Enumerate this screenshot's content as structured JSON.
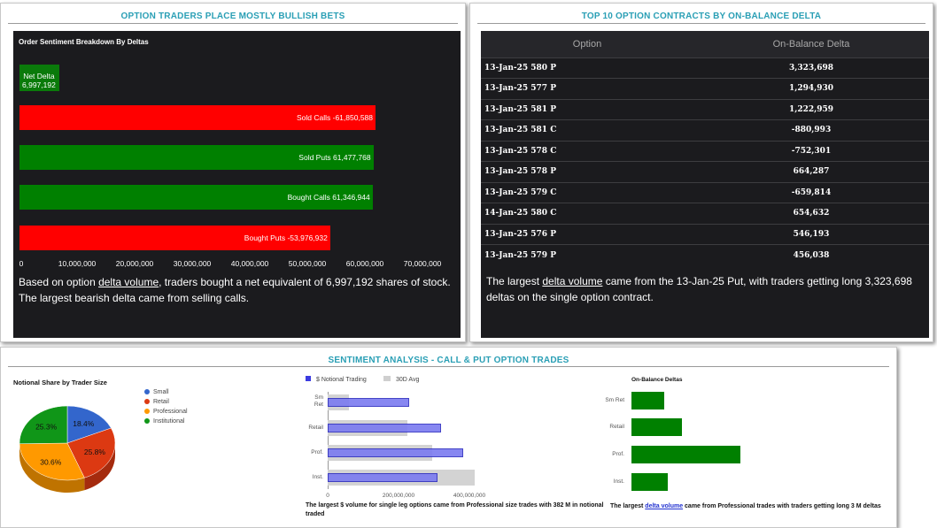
{
  "left_panel": {
    "title": "OPTION TRADERS PLACE MOSTLY BULLISH BETS",
    "chart_data": {
      "type": "bar",
      "orientation": "horizontal",
      "title": "Order Sentiment Breakdown By Deltas",
      "categories": [
        "Net Delta",
        "Sold Calls",
        "Sold Puts",
        "Bought Calls",
        "Bought Puts"
      ],
      "values": [
        6997192,
        -61850588,
        61477768,
        61346944,
        -53976932
      ],
      "labels": [
        "Net Delta\n6,997,192",
        "Sold Calls -61,850,588",
        "Sold Puts 61,477,768",
        "Bought Calls 61,346,944",
        "Bought Puts -53,976,932"
      ],
      "colors": [
        "#0a7a0a",
        "#ff0000",
        "#008000",
        "#008000",
        "#ff0000"
      ],
      "xlim": [
        0,
        70000000
      ],
      "xticks": [
        "0",
        "10,000,000",
        "20,000,000",
        "30,000,000",
        "40,000,000",
        "50,000,000",
        "60,000,000",
        "70,000,000"
      ],
      "xtick_values": [
        0,
        10000000,
        20000000,
        30000000,
        40000000,
        50000000,
        60000000,
        70000000
      ]
    },
    "desc_pre": "Based on option ",
    "desc_link": "delta volume",
    "desc_post": ", traders bought a net equivalent of 6,997,192 shares of stock. The largest bearish delta came from selling calls."
  },
  "right_panel": {
    "title": "TOP 10 OPTION CONTRACTS BY ON-BALANCE DELTA",
    "col_option": "Option",
    "col_delta": "On-Balance Delta",
    "rows": [
      {
        "option": "13-Jan-25 580 P",
        "delta": "3,323,698"
      },
      {
        "option": "13-Jan-25 577 P",
        "delta": "1,294,930"
      },
      {
        "option": "13-Jan-25 581 P",
        "delta": "1,222,959"
      },
      {
        "option": "13-Jan-25 581 C",
        "delta": "-880,993"
      },
      {
        "option": "13-Jan-25 578 C",
        "delta": "-752,301"
      },
      {
        "option": "13-Jan-25 578 P",
        "delta": "664,287"
      },
      {
        "option": "13-Jan-25 579 C",
        "delta": "-659,814"
      },
      {
        "option": "14-Jan-25 580 C",
        "delta": "654,632"
      },
      {
        "option": "13-Jan-25 576 P",
        "delta": "546,193"
      },
      {
        "option": "13-Jan-25 579 P",
        "delta": "456,038"
      }
    ],
    "desc_pre": "The largest ",
    "desc_link": "delta volume",
    "desc_post": " came from the 13-Jan-25 Put, with traders getting long 3,323,698 deltas on the single option contract."
  },
  "bottom_panel": {
    "title": "SENTIMENT ANALYSIS - CALL & PUT OPTION TRADES",
    "chart_data": [
      {
        "type": "pie",
        "title": "Notional Share by Trader Size",
        "categories": [
          "Small",
          "Retail",
          "Professional",
          "Institutional"
        ],
        "values": [
          18.4,
          25.8,
          30.6,
          25.3
        ],
        "labels": [
          "18.4%",
          "25.8%",
          "30.6%",
          "25.3%"
        ],
        "colors": [
          "#3366cc",
          "#dc3912",
          "#ff9900",
          "#109618"
        ]
      },
      {
        "type": "bar",
        "orientation": "horizontal",
        "categories": [
          "Sm Ret",
          "Retail",
          "Prof.",
          "Inst."
        ],
        "series": [
          {
            "name": "$ Notional Trading",
            "values": [
              230000000,
              320000000,
              382000000,
              310000000
            ],
            "color": "#7b7bf0"
          },
          {
            "name": "30D Avg",
            "values": [
              60000000,
              225000000,
              295000000,
              415000000
            ],
            "color": "#d3d3d3"
          }
        ],
        "xlim": [
          0,
          450000000
        ],
        "xticks": [
          "0",
          "200,000,000",
          "400,000,000"
        ],
        "xtick_values": [
          0,
          200000000,
          400000000
        ]
      },
      {
        "type": "bar",
        "orientation": "horizontal",
        "title": "On-Balance Deltas",
        "categories": [
          "Sm Ret",
          "Retail",
          "Prof.",
          "Inst."
        ],
        "values": [
          0.9,
          1.4,
          3.0,
          1.0
        ],
        "color": "#008000"
      }
    ],
    "sm_ret_line1": "Sm",
    "sm_ret_line2": "Ret",
    "foot_left": "The largest $ volume for single leg options came from Professional size trades with 382 M in notional traded",
    "foot_right_pre": "The largest ",
    "foot_right_link": "delta volume",
    "foot_right_post": " came from Professional trades with traders getting long 3 M deltas"
  }
}
